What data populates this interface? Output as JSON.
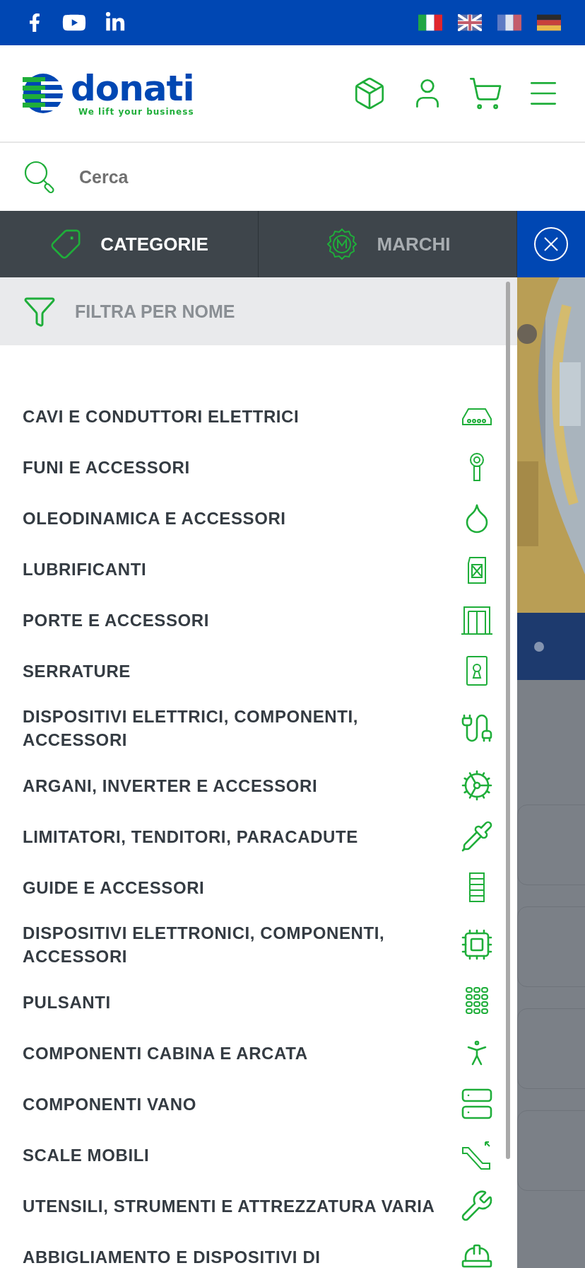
{
  "logo": {
    "name": "donati",
    "tagline": "We lift your business"
  },
  "search": {
    "placeholder": "Cerca"
  },
  "tabs": [
    {
      "label": "CATEGORIE",
      "selected": true
    },
    {
      "label": "MARCHI",
      "selected": false
    }
  ],
  "filter": {
    "placeholder": "FILTRA PER NOME"
  },
  "categories": [
    {
      "label": "CAVI E CONDUTTORI ELETTRICI"
    },
    {
      "label": "FUNI E ACCESSORI"
    },
    {
      "label": "OLEODINAMICA E ACCESSORI"
    },
    {
      "label": "LUBRIFICANTI"
    },
    {
      "label": "PORTE E ACCESSORI"
    },
    {
      "label": "SERRATURE"
    },
    {
      "label": "DISPOSITIVI ELETTRICI, COMPONENTI, ACCESSORI"
    },
    {
      "label": "ARGANI, INVERTER E ACCESSORI"
    },
    {
      "label": "LIMITATORI, TENDITORI, PARACADUTE"
    },
    {
      "label": "GUIDE E ACCESSORI"
    },
    {
      "label": "DISPOSITIVI ELETTRONICI, COMPONENTI, ACCESSORI"
    },
    {
      "label": "PULSANTI"
    },
    {
      "label": "COMPONENTI CABINA E ARCATA"
    },
    {
      "label": "COMPONENTI VANO"
    },
    {
      "label": "SCALE MOBILI"
    },
    {
      "label": "UTENSILI, STRUMENTI E ATTREZZATURA VARIA"
    },
    {
      "label": "ABBIGLIAMENTO E DISPOSITIVI DI"
    }
  ]
}
